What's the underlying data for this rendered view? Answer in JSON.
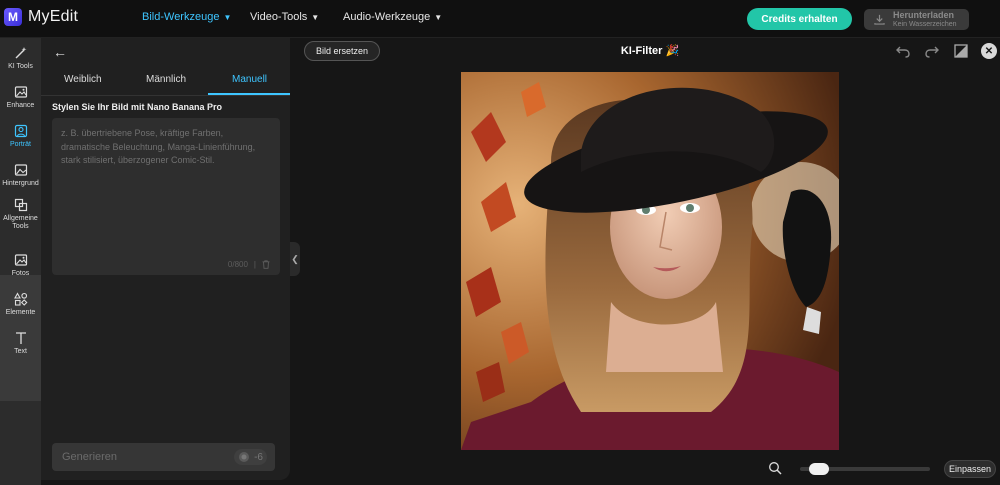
{
  "app": {
    "name": "MyEdit",
    "logo_letter": "M"
  },
  "nav": {
    "items": [
      {
        "label": "Bild-Werkzeuge",
        "active": true
      },
      {
        "label": "Video-Tools",
        "active": false
      },
      {
        "label": "Audio-Werkzeuge",
        "active": false
      }
    ]
  },
  "header": {
    "credits_label": "Credits erhalten",
    "download_label": "Herunterladen",
    "download_sublabel": "Kein Wasserzeichen"
  },
  "rail": {
    "items": [
      {
        "label": "KI Tools",
        "icon": "magic-wand-icon",
        "active": false
      },
      {
        "label": "Enhance",
        "icon": "image-enhance-icon",
        "active": false
      },
      {
        "label": "Porträt",
        "icon": "portrait-icon",
        "active": true
      },
      {
        "label": "Hintergrund",
        "icon": "background-icon",
        "active": false
      },
      {
        "label": "Allgemeine Tools",
        "icon": "crop-tools-icon",
        "active": false
      },
      {
        "label": "Fotos",
        "icon": "photo-icon",
        "active": false
      },
      {
        "label": "Elemente",
        "icon": "shapes-icon",
        "active": false
      },
      {
        "label": "Text",
        "icon": "text-icon",
        "active": false
      }
    ]
  },
  "panel": {
    "tabs": [
      {
        "label": "Weiblich",
        "active": false
      },
      {
        "label": "Männlich",
        "active": false
      },
      {
        "label": "Manuell",
        "active": true
      }
    ],
    "section_title": "Stylen Sie Ihr Bild mit Nano Banana Pro",
    "prompt_placeholder": "z. B. übertriebene Pose, kräftige Farben, dramatische Beleuchtung, Manga-Linienführung, stark stilisiert, überzogener Comic-Stil.",
    "prompt_value": "",
    "char_counter": "0/800",
    "generate_label": "Generieren",
    "generate_cost": "-6"
  },
  "canvas": {
    "replace_label": "Bild ersetzen",
    "title": "KI-Filter",
    "title_emoji": "🎉",
    "fit_label": "Einpassen",
    "zoom_level": 0.08
  },
  "colors": {
    "accent": "#3ec5ff",
    "credits_button": "#22c6a8",
    "logo": "#5446f0"
  }
}
